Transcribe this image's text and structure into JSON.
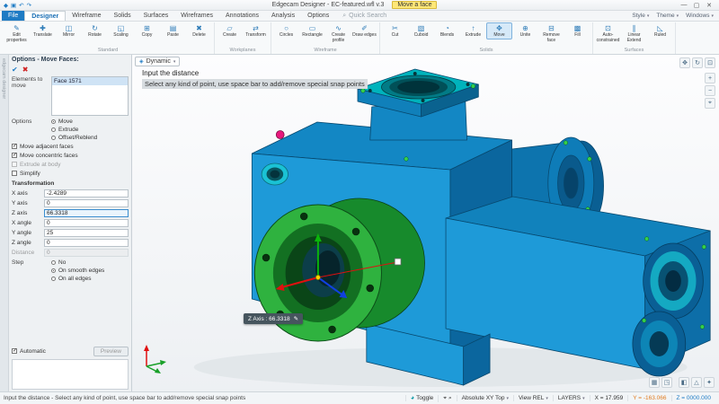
{
  "colors": {
    "accent": "#1e7bc4",
    "badge_yellow": "#ffe878",
    "model_blue": "#1e9ad8",
    "model_teal": "#00b3bc",
    "highlight_green": "#2fb23f",
    "select_pink": "#e8197d",
    "coord_y_orange": "#e07b20"
  },
  "icons": {
    "app": "◆",
    "save": "▣",
    "undo": "↶",
    "redo": "↷",
    "caret": "▾",
    "search": "⌕",
    "dynamic": "◈",
    "pencil": "✎",
    "pan": "✥",
    "orbit": "↻",
    "fit": "⊡",
    "zoom_in": "+",
    "zoom_out": "−",
    "zoom_window": "⌖",
    "grid": "▦",
    "workplane": "◳",
    "shaded": "◧",
    "measure": "△",
    "settings": "✦",
    "toggle": "◕",
    "target": "⌖",
    "magnet": "⌕",
    "confirm": "✔",
    "cancel": "✖"
  },
  "titlebar": {
    "title": "Edgecam Designer - EC-featured.wfl v.3",
    "badge": "Move a face",
    "minimize": "—",
    "maximize": "▢",
    "close": "✕"
  },
  "tabs": {
    "items": [
      {
        "label": "File",
        "accent": true,
        "name": "tab-file"
      },
      {
        "label": "Designer",
        "active": true,
        "name": "tab-designer"
      },
      {
        "label": "Wireframe",
        "name": "tab-wireframe"
      },
      {
        "label": "Solids",
        "name": "tab-solids"
      },
      {
        "label": "Surfaces",
        "name": "tab-surfaces"
      },
      {
        "label": "Wireframes",
        "name": "tab-wireframes"
      },
      {
        "label": "Annotations",
        "name": "tab-annotations"
      },
      {
        "label": "Analysis",
        "name": "tab-analysis"
      },
      {
        "label": "Options",
        "name": "tab-options"
      }
    ],
    "quick_search": "Quick Search",
    "right_items": [
      {
        "label": "Style",
        "name": "style-menu"
      },
      {
        "label": "Theme",
        "name": "theme-menu"
      },
      {
        "label": "Windows",
        "name": "windows-menu"
      }
    ]
  },
  "ribbon": {
    "groups": [
      {
        "label": "Standard",
        "buttons": [
          {
            "label": "Edit properties",
            "name": "edit-properties",
            "glyph": "✎"
          },
          {
            "label": "Translate",
            "name": "translate",
            "glyph": "✚"
          },
          {
            "label": "Mirror",
            "name": "mirror",
            "glyph": "◫"
          },
          {
            "label": "Rotate",
            "name": "rotate",
            "glyph": "↻"
          },
          {
            "label": "Scaling",
            "name": "scaling",
            "glyph": "◱"
          },
          {
            "label": "Copy",
            "name": "copy",
            "glyph": "⊞"
          },
          {
            "label": "Paste",
            "name": "paste",
            "glyph": "▤"
          },
          {
            "label": "Delete",
            "name": "delete",
            "glyph": "✖"
          }
        ]
      },
      {
        "label": "Workplanes",
        "buttons": [
          {
            "label": "Create",
            "name": "create-workplane",
            "glyph": "▱"
          },
          {
            "label": "Transform",
            "name": "transform-workplane",
            "glyph": "⇄"
          }
        ]
      },
      {
        "label": "Wireframe",
        "buttons": [
          {
            "label": "Circles",
            "name": "circles",
            "glyph": "○"
          },
          {
            "label": "Rectangle",
            "name": "rectangle",
            "glyph": "▭"
          },
          {
            "label": "Create profile",
            "name": "create-profile",
            "glyph": "∿"
          },
          {
            "label": "Draw edges",
            "name": "draw-edges",
            "glyph": "✐"
          }
        ]
      },
      {
        "label": "Solids",
        "buttons": [
          {
            "label": "Cut",
            "name": "cut",
            "glyph": "✂"
          },
          {
            "label": "Cuboid",
            "name": "cuboid",
            "glyph": "▧"
          },
          {
            "label": "Blends",
            "name": "blends",
            "glyph": "◔"
          },
          {
            "label": "Extrude",
            "name": "extrude",
            "glyph": "↑"
          },
          {
            "label": "Move",
            "name": "move",
            "glyph": "✥",
            "active": true
          },
          {
            "label": "Unite",
            "name": "unite",
            "glyph": "⊕"
          },
          {
            "label": "Remove face",
            "name": "remove-face",
            "glyph": "⊟"
          },
          {
            "label": "Fill",
            "name": "fill",
            "glyph": "▩"
          }
        ]
      },
      {
        "label": "Surfaces",
        "buttons": [
          {
            "label": "Auto-constrained",
            "name": "auto-constrained",
            "glyph": "⊡"
          },
          {
            "label": "Linear Extend",
            "name": "linear-extend",
            "glyph": "∥"
          },
          {
            "label": "Ruled",
            "name": "ruled",
            "glyph": "◺"
          }
        ]
      }
    ]
  },
  "dock": {
    "label": "edgecam designer"
  },
  "panel": {
    "title": "Options - Move Faces:",
    "elements_label": "Elements to move",
    "elements": [
      {
        "label": "Face 1571"
      }
    ],
    "options_label": "Options",
    "option_radios": [
      {
        "label": "Move",
        "selected": true
      },
      {
        "label": "Extrude"
      },
      {
        "label": "Offset/Reblend"
      }
    ],
    "checkboxes": [
      {
        "label": "Move adjacent faces",
        "checked": true
      },
      {
        "label": "Move concentric faces",
        "checked": true
      },
      {
        "label": "Extrude at body",
        "disabled": true
      },
      {
        "label": "Simplify"
      }
    ],
    "transformation_label": "Transformation",
    "fields": [
      {
        "label": "X axis",
        "value": "-2.4289"
      },
      {
        "label": "Y axis",
        "value": "0"
      },
      {
        "label": "Z axis",
        "value": "66.3318",
        "active": true
      },
      {
        "label": "X angle",
        "value": "0"
      },
      {
        "label": "Y angle",
        "value": "25"
      },
      {
        "label": "Z angle",
        "value": "0"
      },
      {
        "label": "Distance",
        "value": "0",
        "disabled": true
      }
    ],
    "step_label": "Step",
    "step_radios": [
      {
        "label": "No"
      },
      {
        "label": "On smooth edges",
        "selected": true
      },
      {
        "label": "On all edges"
      }
    ],
    "automatic_label": "Automatic",
    "preview_label": "Preview"
  },
  "viewport": {
    "dynamic_label": "Dynamic",
    "prompt_line1": "Input the distance",
    "prompt_line2": "Select any kind of point, use space bar to add/remove special snap points",
    "tooltip": "Z Axis : 66.3318"
  },
  "statusbar": {
    "left_text": "Input the distance - Select any kind of point, use space bar to add/remove special snap points",
    "toggle_label": "Toggle",
    "coord_mode": "Absolute XY Top",
    "view_mode": "View REL",
    "layers_label": "LAYERS",
    "x": "X = 17.959",
    "y": "Y = -163.066",
    "z": "Z = 0000.000"
  }
}
